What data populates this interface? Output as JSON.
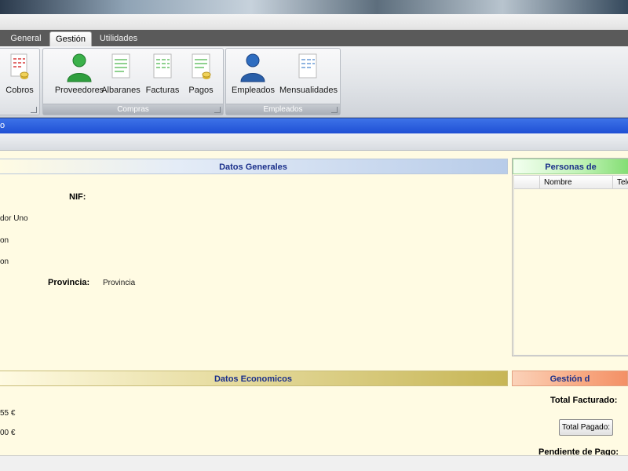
{
  "tabs": [
    "General",
    "Gestión",
    "Utilidades"
  ],
  "ribbon": {
    "cobros_label": "Cobros",
    "compras": {
      "label": "Compras",
      "buttons": [
        "Proveedores",
        "Albaranes",
        "Facturas",
        "Pagos"
      ]
    },
    "empleados": {
      "label": "Empleados",
      "buttons": [
        "Empleados",
        "Mensualidades"
      ]
    }
  },
  "bluebar_text": "o",
  "datos_generales": {
    "title": "Datos Generales",
    "nif_label": "NIF:",
    "partial_values": [
      "dor Uno",
      "on",
      "on"
    ],
    "provincia_label": "Provincia:",
    "provincia_value": "Provincia"
  },
  "personas": {
    "title": "Personas de",
    "columns": [
      "Nombre",
      "Tele"
    ]
  },
  "datos_economicos": {
    "title": "Datos Economicos",
    "partial_values": [
      "55 €",
      "00 €"
    ]
  },
  "gestion": {
    "title": "Gestión d",
    "total_facturado_label": "Total Facturado:",
    "total_pagado_button": "Total Pagado:",
    "pendiente_label": "Pendiente de Pago:"
  },
  "colors": {
    "accent_blue": "#1f4fd4",
    "panel_background": "#fffbe3"
  }
}
